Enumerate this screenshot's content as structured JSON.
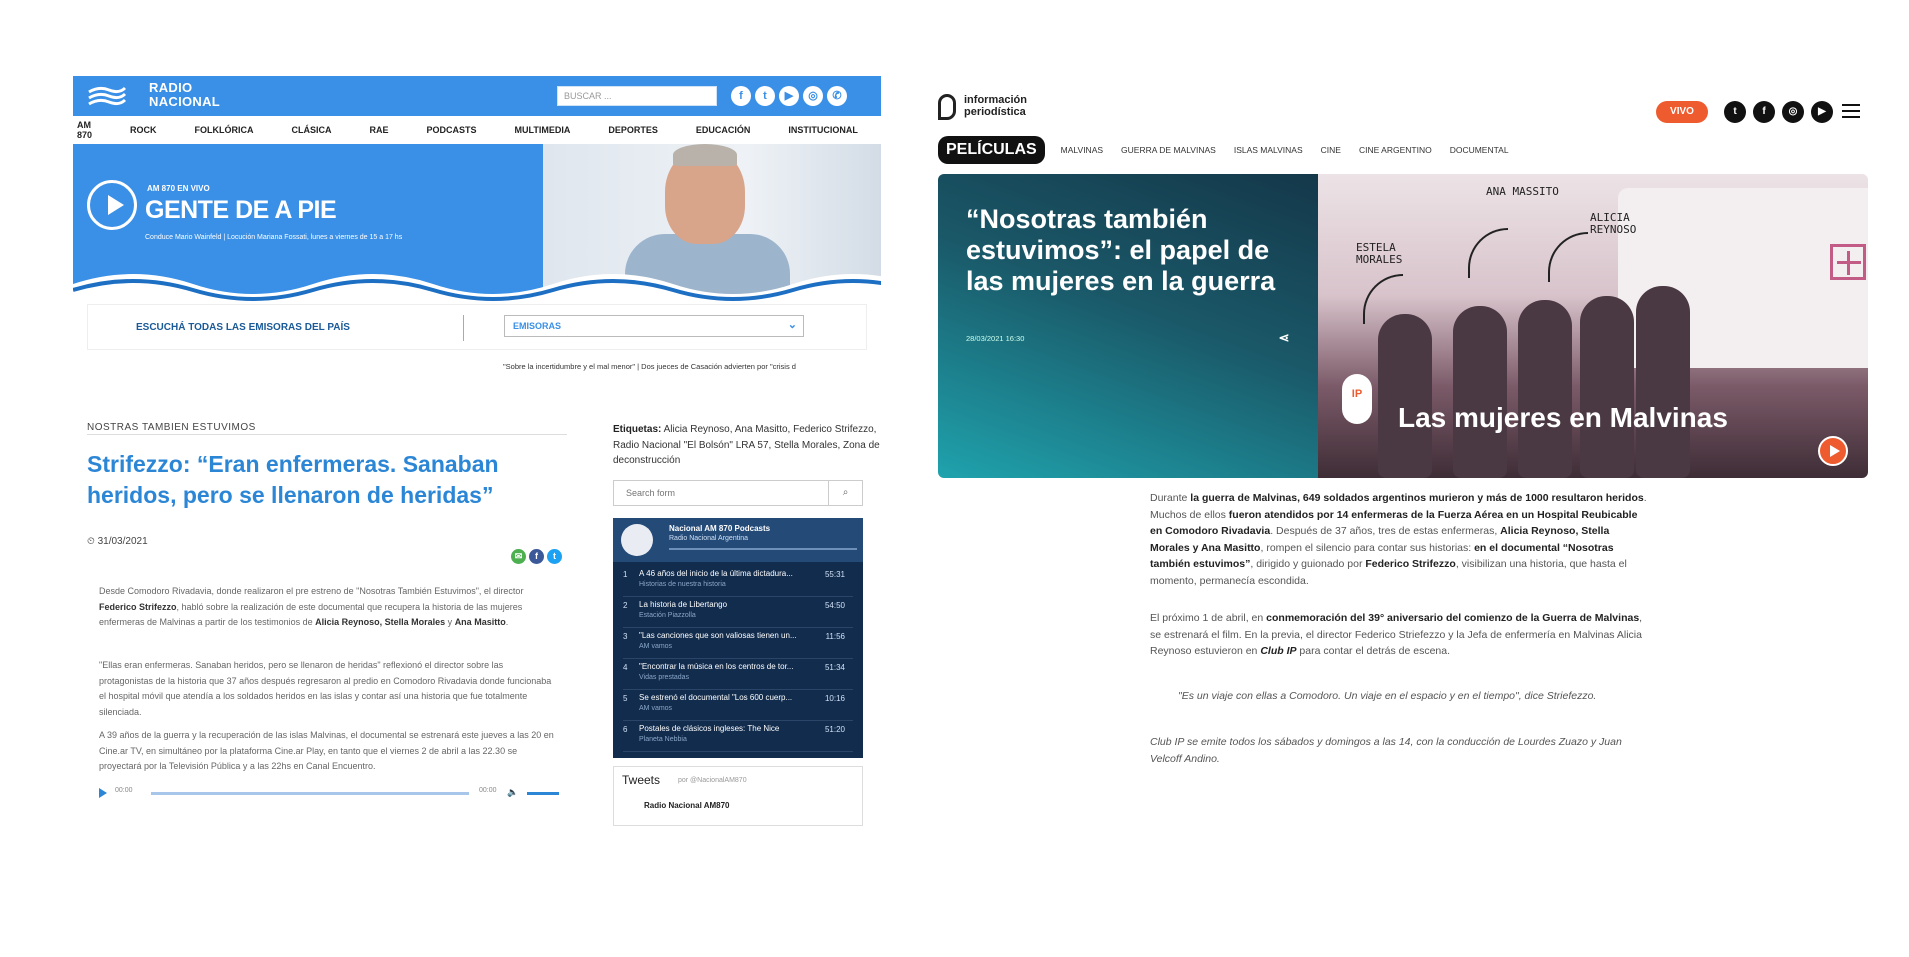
{
  "radio_nacional": {
    "logo": {
      "line1": "RADIO",
      "line2": "NACIONAL"
    },
    "search_placeholder": "BUSCAR ...",
    "social_icons": [
      "facebook-icon",
      "twitter-icon",
      "youtube-icon",
      "instagram-icon",
      "whatsapp-icon"
    ],
    "nav": [
      "AM 870",
      "ROCK",
      "FOLKLÓRICA",
      "CLÁSICA",
      "RAE",
      "PODCASTS",
      "MULTIMEDIA",
      "DEPORTES",
      "EDUCACIÓN",
      "INSTITUCIONAL"
    ],
    "banner": {
      "onair": "AM 870 EN VIVO",
      "show": "GENTE DE A PIE",
      "credits": "Conduce Mario Wainfeld | Locución Mariana Fossati, lunes a viernes de 15 a 17 hs"
    },
    "emisoras": {
      "label": "ESCUCHÁ TODAS LAS EMISORAS DEL PAÍS",
      "select": "EMISORAS"
    },
    "ticker": "\"Sobre la incertidumbre y el mal menor\" | Dos jueces de Casación advierten por \"crisis d",
    "article": {
      "kicker": "NOSTRAS TAMBIEN ESTUVIMOS",
      "title": "Strifezzo: “Eran enfermeras. Sanaban heridos, pero se llenaron de heridas”",
      "date": "31/03/2021",
      "p1_a": "Desde Comodoro Rivadavia, donde realizaron el pre estreno de \"Nosotras También Estuvimos\", el director ",
      "p1_b": "Federico Strifezzo",
      "p1_c": ", habló sobre la realización de este documental que recupera la historia de las mujeres enfermeras de Malvinas a partir de los testimonios de ",
      "p1_d": "Alicia Reynoso, Stella Morales",
      "p1_e": " y ",
      "p1_f": "Ana Masitto",
      "p1_g": ".",
      "p2": "\"Ellas eran enfermeras. Sanaban heridos, pero se llenaron de heridas\" reflexionó el director sobre las protagonistas de la historia que 37 años después regresaron al predio en Comodoro Rivadavia donde funcionaba el hospital móvil que atendía a los soldados heridos en las islas y contar así una historia que fue totalmente silenciada.",
      "p3": "A 39 años de la guerra y la recuperación de las islas Malvinas, el documental se estrenará este jueves a las 20 en Cine.ar TV, en simultáneo por la plataforma Cine.ar Play, en tanto que el viernes 2 de abril a las 22.30 se proyectará por la Televisión Pública y a las 22hs en Canal Encuentro.",
      "audio_start": "00:00",
      "audio_end": "00:00"
    },
    "tags": {
      "label": "Etiquetas:",
      "text": "Alicia Reynoso, Ana Masitto, Federico Strifezzo, Radio Nacional \"El Bolsón\" LRA 57, Stella Morales, Zona de deconstrucción"
    },
    "search_form_placeholder": "Search form",
    "podcast": {
      "title": "Nacional AM 870 Podcasts",
      "subtitle": "Radio Nacional Argentina",
      "tracks": [
        {
          "n": "1",
          "title": "A 46 años del inicio de la última dictadura...",
          "sub": "Historias de nuestra historia",
          "dur": "55:31"
        },
        {
          "n": "2",
          "title": "La historia de Libertango",
          "sub": "Estación Piazzolla",
          "dur": "54:50"
        },
        {
          "n": "3",
          "title": "\"Las canciones que son valiosas tienen un...",
          "sub": "AM vamos",
          "dur": "11:56"
        },
        {
          "n": "4",
          "title": "\"Encontrar la música en los centros de tor...",
          "sub": "Vidas prestadas",
          "dur": "51:34"
        },
        {
          "n": "5",
          "title": "Se estrenó el documental \"Los 600 cuerp...",
          "sub": "AM vamos",
          "dur": "10:16"
        },
        {
          "n": "6",
          "title": "Postales de clásicos ingleses: The Nice",
          "sub": "Planeta Nebbia",
          "dur": "51:20"
        }
      ]
    },
    "tweets": {
      "title": "Tweets",
      "by": "por @NacionalAM870",
      "user": "Radio Nacional AM870"
    }
  },
  "informacion_periodistica": {
    "logo": {
      "line1": "información",
      "line2": "periodística"
    },
    "vivo": "VIVO",
    "social_icons": [
      "twitter-icon",
      "facebook-icon",
      "instagram-icon",
      "youtube-icon"
    ],
    "nav_active": "PELÍCULAS",
    "nav": [
      "MALVINAS",
      "GUERRA DE MALVINAS",
      "ISLAS MALVINAS",
      "CINE",
      "CINE ARGENTINO",
      "DOCUMENTAL"
    ],
    "hero": {
      "title": "“Nosotras también estuvimos”: el papel de las mujeres en la guerra",
      "date": "28/03/2021 16:30",
      "annot1": "ESTELA MORALES",
      "annot2": "ANA MASSITO",
      "annot3": "ALICIA REYNOSO",
      "badge": "IP",
      "caption": "Las mujeres en Malvinas"
    },
    "body": {
      "p1_a": "Durante ",
      "p1_b": "la guerra de Malvinas, 649 soldados argentinos murieron y más de 1000 resultaron heridos",
      "p1_c": ". Muchos de ellos ",
      "p1_d": "fueron atendidos por 14 enfermeras de la Fuerza Aérea en un Hospital Reubicable en Comodoro Rivadavia",
      "p1_e": ". Después de 37 años, tres de estas enfermeras, ",
      "p1_f": "Alicia Reynoso, Stella Morales y Ana Masitto",
      "p1_g": ", rompen el silencio para contar sus historias: ",
      "p1_h": "en el documental “Nosotras también estuvimos”",
      "p1_i": ", dirigido y guionado por ",
      "p1_j": "Federico Strifezzo",
      "p1_k": ", visibilizan una historia, que hasta el momento, permanecía escondida.",
      "p2_a": "El próximo 1 de abril, en ",
      "p2_b": "conmemoración del 39° aniversario del comienzo de la Guerra de Malvinas",
      "p2_c": ", se estrenará el film. En la previa, el director Federico Striefezzo y la Jefa de enfermería en Malvinas Alicia Reynoso estuvieron en ",
      "p2_d": "Club IP",
      "p2_e": " para contar el detrás de escena.",
      "quote": "\"Es un viaje con ellas a Comodoro. Un viaje en el espacio y en el tiempo\", dice Striefezzo.",
      "foot": "Club IP se emite todos los sábados y domingos a las 14, con la conducción de Lourdes Zuazo y Juan Velcoff Andino."
    }
  }
}
